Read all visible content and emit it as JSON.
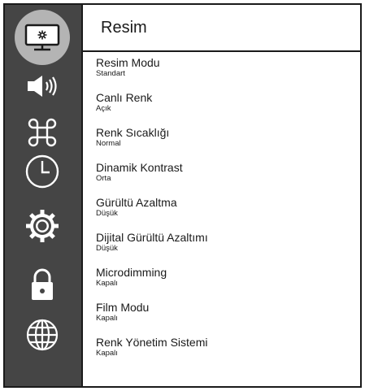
{
  "sidebar": {
    "items": [
      {
        "icon": "picture-settings-icon",
        "active": true
      },
      {
        "icon": "speaker-icon"
      },
      {
        "icon": "command-icon"
      },
      {
        "icon": "clock-icon"
      },
      {
        "icon": "gear-icon"
      },
      {
        "icon": "lock-icon"
      },
      {
        "icon": "globe-icon"
      }
    ]
  },
  "main": {
    "title": "Resim",
    "items": [
      {
        "label": "Resim Modu",
        "value": "Standart"
      },
      {
        "label": "Canlı Renk",
        "value": "Açık"
      },
      {
        "label": "Renk Sıcaklığı",
        "value": "Normal"
      },
      {
        "label": "Dinamik Kontrast",
        "value": "Orta"
      },
      {
        "label": "Gürültü Azaltma",
        "value": "Düşük"
      },
      {
        "label": "Dijital Gürültü Azaltımı",
        "value": "Düşük"
      },
      {
        "label": "Microdimming",
        "value": "Kapalı"
      },
      {
        "label": "Film Modu",
        "value": "Kapalı"
      },
      {
        "label": "Renk Yönetim Sistemi",
        "value": "Kapalı"
      }
    ]
  }
}
